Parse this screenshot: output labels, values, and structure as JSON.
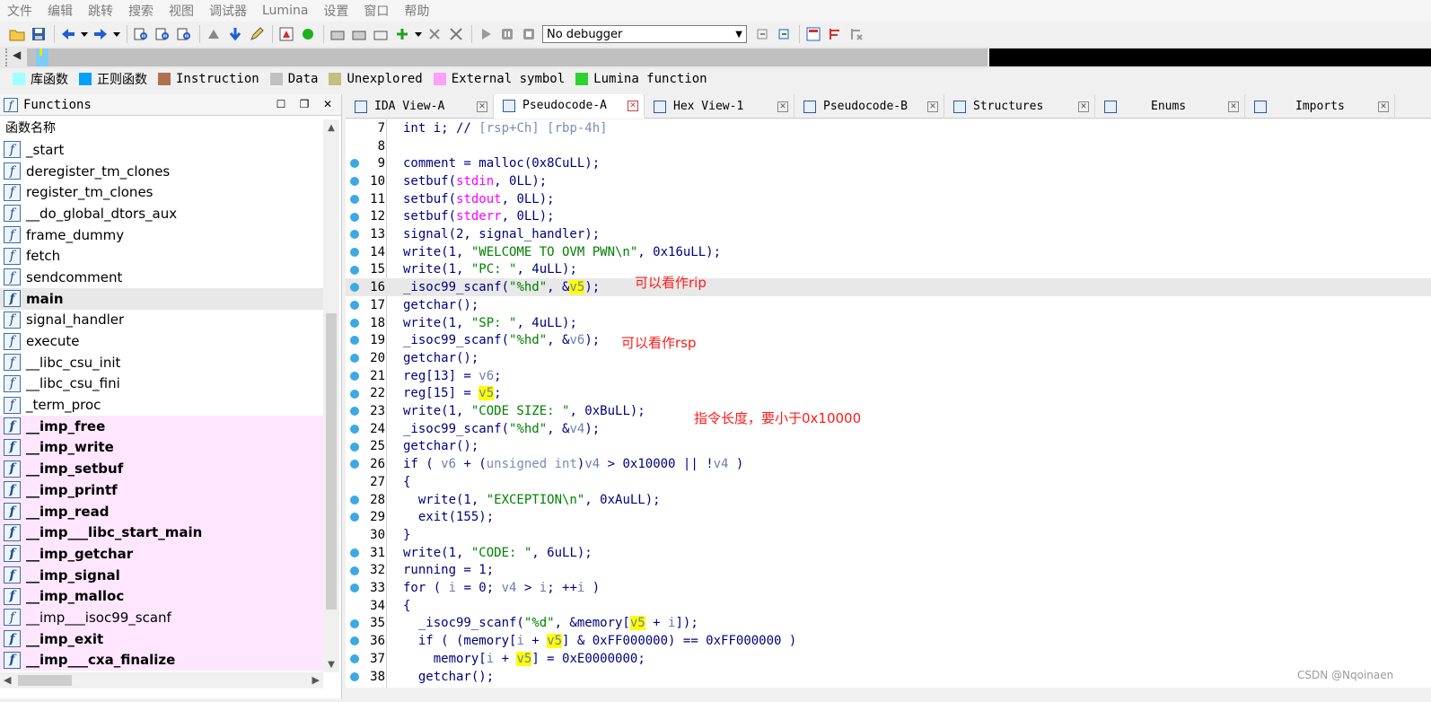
{
  "menu": [
    "文件",
    "编辑",
    "跳转",
    "搜索",
    "视图",
    "调试器",
    "Lumina",
    "设置",
    "窗口",
    "帮助"
  ],
  "toolbar": {
    "debugger_value": "No debugger"
  },
  "legend": [
    {
      "label": "库函数",
      "color": "#a0ffff"
    },
    {
      "label": "正则函数",
      "color": "#00a0ff"
    },
    {
      "label": "Instruction",
      "color": "#b07050"
    },
    {
      "label": "Data",
      "color": "#c0c0c0"
    },
    {
      "label": "Unexplored",
      "color": "#c0c080"
    },
    {
      "label": "External symbol",
      "color": "#ffa0ff"
    },
    {
      "label": "Lumina function",
      "color": "#30d030"
    }
  ],
  "functions_panel": {
    "title": "Functions",
    "column_header": "函数名称",
    "items": [
      {
        "name": "_start",
        "style": "normal"
      },
      {
        "name": "deregister_tm_clones",
        "style": "normal"
      },
      {
        "name": "register_tm_clones",
        "style": "normal"
      },
      {
        "name": "__do_global_dtors_aux",
        "style": "normal"
      },
      {
        "name": "frame_dummy",
        "style": "normal"
      },
      {
        "name": "fetch",
        "style": "normal"
      },
      {
        "name": "sendcomment",
        "style": "normal"
      },
      {
        "name": "main",
        "style": "selected"
      },
      {
        "name": "signal_handler",
        "style": "normal"
      },
      {
        "name": "execute",
        "style": "normal"
      },
      {
        "name": "__libc_csu_init",
        "style": "normal"
      },
      {
        "name": "__libc_csu_fini",
        "style": "normal"
      },
      {
        "name": "_term_proc",
        "style": "normal"
      },
      {
        "name": "__imp_free",
        "style": "imported"
      },
      {
        "name": "__imp_write",
        "style": "imported"
      },
      {
        "name": "__imp_setbuf",
        "style": "imported"
      },
      {
        "name": "__imp_printf",
        "style": "imported"
      },
      {
        "name": "__imp_read",
        "style": "imported"
      },
      {
        "name": "__imp___libc_start_main",
        "style": "imported"
      },
      {
        "name": "__imp_getchar",
        "style": "imported"
      },
      {
        "name": "__imp_signal",
        "style": "imported"
      },
      {
        "name": "__imp_malloc",
        "style": "imported"
      },
      {
        "name": "__imp___isoc99_scanf",
        "style": "imported-normal"
      },
      {
        "name": "__imp_exit",
        "style": "imported"
      },
      {
        "name": "__imp___cxa_finalize",
        "style": "imported"
      }
    ]
  },
  "tabs": [
    {
      "label": "IDA View-A",
      "active": false
    },
    {
      "label": "Pseudocode-A",
      "active": true
    },
    {
      "label": "Hex View-1",
      "active": false
    },
    {
      "label": "Pseudocode-B",
      "active": false
    },
    {
      "label": "Structures",
      "active": false
    },
    {
      "label": "Enums",
      "active": false
    },
    {
      "label": "Imports",
      "active": false
    }
  ],
  "code": {
    "line_numbers": [
      "7",
      "8",
      "9",
      "10",
      "11",
      "12",
      "13",
      "14",
      "15",
      "16",
      "17",
      "18",
      "19",
      "20",
      "21",
      "22",
      "23",
      "24",
      "25",
      "26",
      "27",
      "28",
      "29",
      "30",
      "31",
      "32",
      "33",
      "34",
      "35",
      "36",
      "37",
      "38"
    ],
    "breakpoint_lines": [
      "9",
      "10",
      "11",
      "12",
      "13",
      "14",
      "15",
      "16",
      "17",
      "18",
      "19",
      "20",
      "21",
      "22",
      "23",
      "24",
      "25",
      "26",
      "28",
      "29",
      "31",
      "32",
      "33",
      "35",
      "36",
      "37",
      "38"
    ],
    "highlighted_line": "16"
  },
  "annotations": {
    "rip": "可以看作rip",
    "rsp": "可以看作rsp",
    "code_size": "指令长度，要小于0x10000"
  },
  "watermark": "CSDN @Nqoinaen"
}
